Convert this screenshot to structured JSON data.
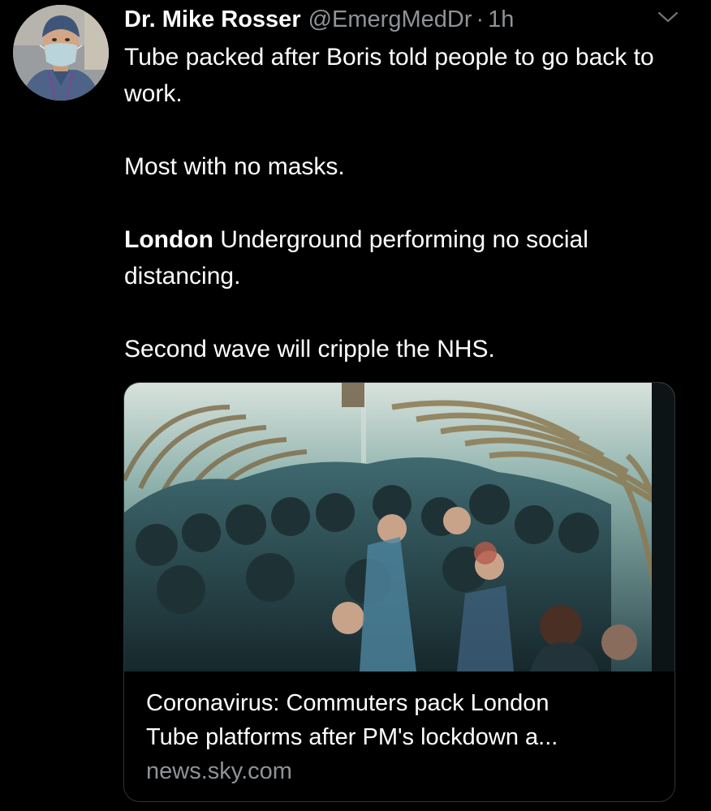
{
  "tweet": {
    "author": {
      "display_name": "Dr. Mike Rosser",
      "handle": "@EmergMedDr",
      "separator": "·",
      "time": "1h",
      "avatar_icon": "profile-photo-masked-doctor"
    },
    "body": {
      "line1": "Tube packed after Boris told people to go back to work.",
      "line2": "Most with no masks.",
      "line3_bold": "London",
      "line3_rest": " Underground performing no social distancing.",
      "line4": "Second wave will cripple the NHS."
    },
    "menu_icon": "chevron-down-icon",
    "card": {
      "image_icon": "crowded-tube-platform-photo",
      "title_line1": "Coronavirus: Commuters pack London",
      "title_line2": "Tube platforms after PM's lockdown a...",
      "domain": "news.sky.com"
    }
  },
  "colors": {
    "background": "#000000",
    "text": "#ffffff",
    "secondary_text": "#8e9398",
    "card_border": "#2f3336"
  }
}
